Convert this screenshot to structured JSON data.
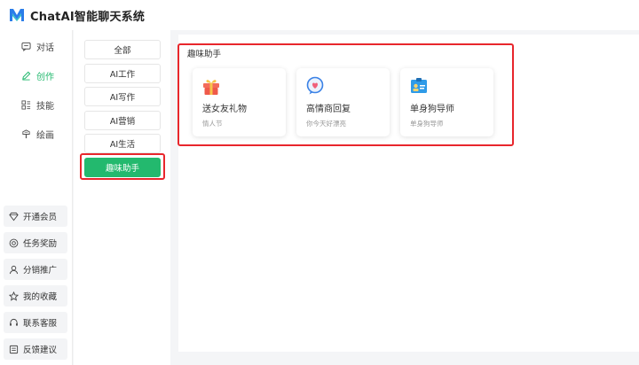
{
  "app": {
    "title": "ChatAI智能聊天系统"
  },
  "sidebar": {
    "items": [
      {
        "label": "对话",
        "icon": "chat-icon"
      },
      {
        "label": "创作",
        "icon": "pen-icon",
        "active": true
      },
      {
        "label": "技能",
        "icon": "skills-icon"
      },
      {
        "label": "绘画",
        "icon": "paint-icon"
      }
    ],
    "bottom": [
      {
        "label": "开通会员",
        "icon": "diamond-icon"
      },
      {
        "label": "任务奖励",
        "icon": "reward-icon"
      },
      {
        "label": "分销推广",
        "icon": "user-icon"
      },
      {
        "label": "我的收藏",
        "icon": "star-icon"
      },
      {
        "label": "联系客服",
        "icon": "headset-icon"
      },
      {
        "label": "反馈建议",
        "icon": "feedback-icon"
      }
    ]
  },
  "categories": {
    "items": [
      {
        "label": "全部"
      },
      {
        "label": "AI工作"
      },
      {
        "label": "AI写作"
      },
      {
        "label": "AI营销"
      },
      {
        "label": "AI生活"
      },
      {
        "label": "趣味助手",
        "active": true
      }
    ]
  },
  "main": {
    "section_title": "趣味助手",
    "cards": [
      {
        "title": "送女友礼物",
        "subtitle": "情人节",
        "icon": "gift-icon"
      },
      {
        "title": "高情商回复",
        "subtitle": "你今天好漂亮",
        "icon": "heart-chat-icon"
      },
      {
        "title": "单身狗导师",
        "subtitle": "单身狗导师",
        "icon": "id-card-icon"
      }
    ]
  },
  "colors": {
    "accent": "#23b96e",
    "highlight": "#e8262c"
  }
}
